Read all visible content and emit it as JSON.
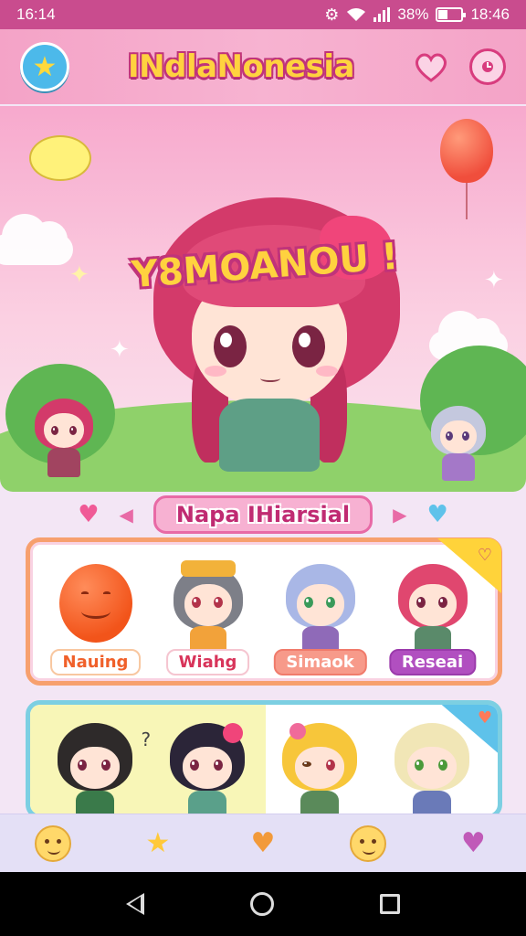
{
  "status_bar": {
    "time_left": "16:14",
    "battery_percent": "38%",
    "battery_fill": 0.38,
    "time_right": "18:46"
  },
  "header": {
    "title": "INdlaNonesia",
    "left_icon": "star-icon",
    "right_icons": [
      "heart-icon",
      "clock-icon"
    ]
  },
  "hero": {
    "title": "Y8MOANOU !"
  },
  "section": {
    "title": "Napa IHiarsial"
  },
  "card1": {
    "characters": [
      {
        "label": "Nauing",
        "label_style": "orange",
        "kind": "balloon"
      },
      {
        "label": "Wiahg",
        "label_style": "red",
        "kind": "chibi"
      },
      {
        "label": "Simaok",
        "label_style": "salmon",
        "kind": "chibi"
      },
      {
        "label": "Reseai",
        "label_style": "purple",
        "kind": "chibi"
      }
    ],
    "corner_icon": "heart-icon"
  },
  "card2": {
    "characters": [
      {
        "kind": "chibi"
      },
      {
        "kind": "chibi"
      },
      {
        "kind": "chibi"
      },
      {
        "kind": "chibi"
      }
    ],
    "question_mark": "?",
    "corner_icon": "heart-icon"
  },
  "bottom_nav": {
    "items": [
      "smiley-icon",
      "star-face-icon",
      "hearts-icon",
      "grin-icon",
      "heart-balloon-icon"
    ]
  },
  "colors": {
    "accent": "#c94c8e",
    "title_yellow": "#ffd23f",
    "pink_bg": "#f7a9cd"
  }
}
